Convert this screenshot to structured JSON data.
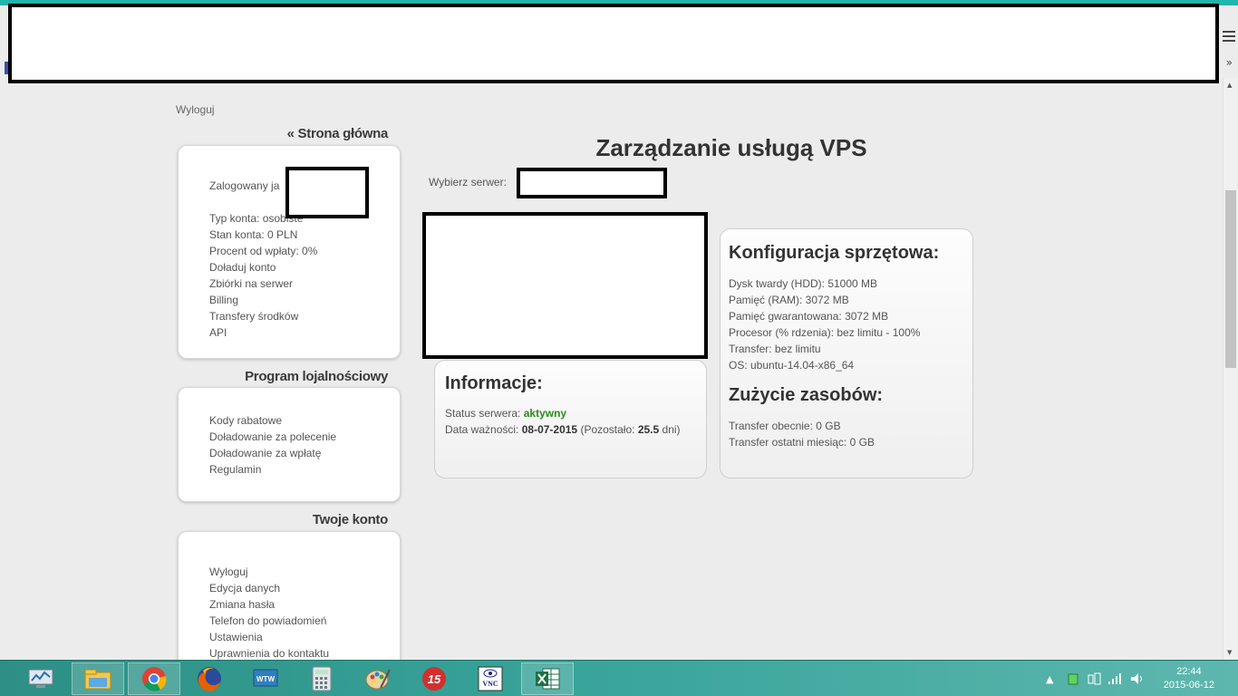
{
  "left": {
    "logout_top": "Wyloguj",
    "home_title": "« Strona główna",
    "account": {
      "logged_in_label": "Zalogowany ja",
      "items": [
        "Typ konta: osobiste",
        "Stan konta: 0 PLN",
        "Procent od wpłaty: 0%",
        "Doładuj konto",
        "Zbiórki na serwer",
        "Billing",
        "Transfery środków",
        "API"
      ]
    },
    "loyalty": {
      "title": "Program lojalnościowy",
      "items": [
        "Kody rabatowe",
        "Doładowanie za polecenie",
        "Doładowanie za wpłatę",
        "Regulamin"
      ]
    },
    "your_account": {
      "title": "Twoje konto",
      "items": [
        "Wyloguj",
        "Edycja danych",
        "Zmiana hasła",
        "Telefon do powiadomień",
        "Ustawienia",
        "Uprawnienia do kontaktu"
      ]
    }
  },
  "main": {
    "title": "Zarządzanie usługą VPS",
    "server_label": "Wybierz serwer:",
    "info": {
      "title": "Informacje:",
      "status_label": "Status serwera:",
      "status_value": "aktywny",
      "expiry_label": "Data ważności:",
      "expiry_value": "08-07-2015",
      "remaining_prefix": "(Pozostało:",
      "remaining_value": "25.5",
      "remaining_suffix": "dni)",
      "status_color": "#2d8a1e"
    },
    "hardware": {
      "title": "Konfiguracja sprzętowa:",
      "rows": [
        "Dysk twardy (HDD): 51000 MB",
        "Pamięć (RAM): 3072 MB",
        "Pamięć gwarantowana: 3072 MB",
        "Procesor (% rdzenia): bez limitu - 100%",
        "Transfer: bez limitu",
        "OS: ubuntu-14.04-x86_64"
      ]
    },
    "usage": {
      "title": "Zużycie zasobów:",
      "rows": [
        "Transfer obecnie: 0 GB",
        "Transfer ostatni miesiąc: 0 GB"
      ]
    }
  },
  "taskbar": {
    "apps": [
      "monitor-app-icon",
      "file-explorer-icon",
      "chrome-icon",
      "firefox-icon",
      "wtw-icon",
      "calculator-icon",
      "paint-icon",
      "app-15-icon",
      "vnc-icon",
      "excel-icon"
    ],
    "wtw_label": "WTW",
    "app15_label": "15",
    "vnc_label": "VNC",
    "time": "22:44",
    "date": "2015-06-12"
  },
  "colors": {
    "accent_teal": "#22b5ad",
    "taskbar": "#3aa59b",
    "page_bg": "#ececec"
  }
}
